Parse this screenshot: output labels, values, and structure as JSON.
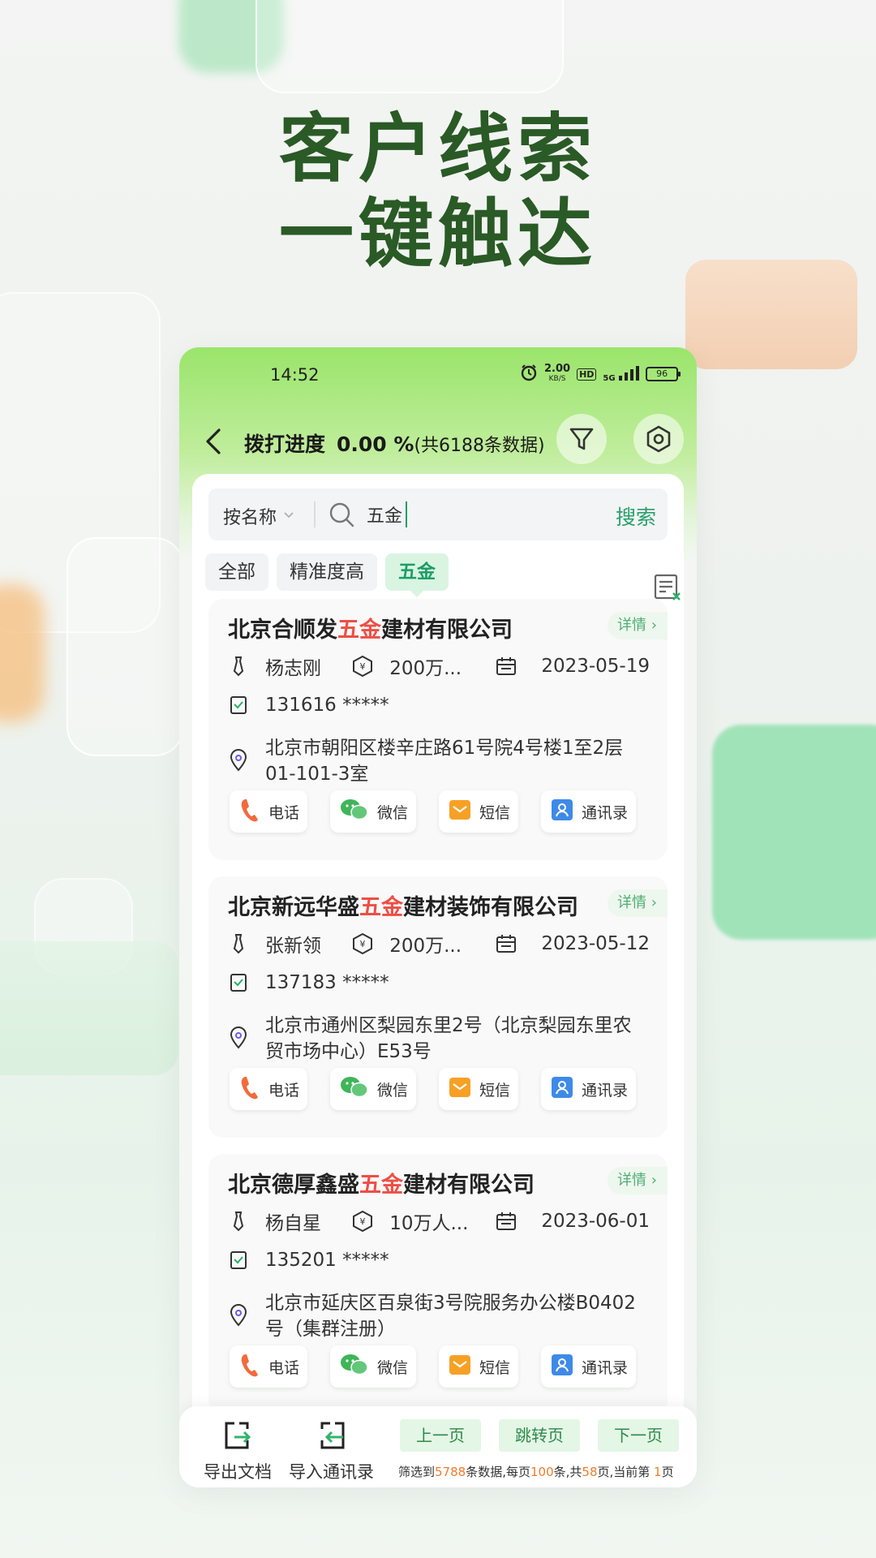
{
  "headline": {
    "line1": "客户线索",
    "line2": "一键触达"
  },
  "status_bar": {
    "time": "14:52",
    "net_speed": "2.00",
    "net_unit": "KB/S",
    "hd": "HD",
    "signal": "5G",
    "battery": "96"
  },
  "nav": {
    "title": "拨打进度",
    "progress": "0.00 %",
    "total": "(共6188条数据)"
  },
  "search": {
    "mode": "按名称",
    "value": "五金",
    "button": "搜索"
  },
  "tags": [
    "全部",
    "精准度高",
    "五金"
  ],
  "cards": [
    {
      "title_pre": "北京合顺发",
      "title_hl": "五金",
      "title_post": "建材有限公司",
      "detail": "详情",
      "person": "杨志刚",
      "capital": "200万...",
      "date": "2023-05-19",
      "phone": "131616 *****",
      "address": "北京市朝阳区楼辛庄路61号院4号楼1至2层01-101-3室"
    },
    {
      "title_pre": "北京新远华盛",
      "title_hl": "五金",
      "title_post": "建材装饰有限公司",
      "detail": "详情",
      "person": "张新领",
      "capital": "200万...",
      "date": "2023-05-12",
      "phone": "137183 *****",
      "address": "北京市通州区梨园东里2号（北京梨园东里农贸市场中心）E53号"
    },
    {
      "title_pre": "北京德厚鑫盛",
      "title_hl": "五金",
      "title_post": "建材有限公司",
      "detail": "详情",
      "person": "杨自星",
      "capital": "10万人...",
      "date": "2023-06-01",
      "phone": "135201 *****",
      "address": "北京市延庆区百泉街3号院服务办公楼B0402号（集群注册）"
    }
  ],
  "actions": {
    "call": "电话",
    "wechat": "微信",
    "sms": "短信",
    "contacts": "通讯录"
  },
  "bottom": {
    "export": "导出文档",
    "import": "导入通讯录",
    "prev": "上一页",
    "jump": "跳转页",
    "next": "下一页",
    "info_a": "筛选到",
    "info_count": "5788",
    "info_b": "条数据,每页",
    "info_per": "100",
    "info_c": "条,共",
    "info_pages": "58",
    "info_d": "页,当前第 ",
    "info_cur": "1",
    "info_e": "页"
  },
  "colors": {
    "brand_green": "#2a5a25",
    "accent_green": "#28a06c",
    "highlight_red": "#ee4e45",
    "orange": "#f07c2b"
  }
}
